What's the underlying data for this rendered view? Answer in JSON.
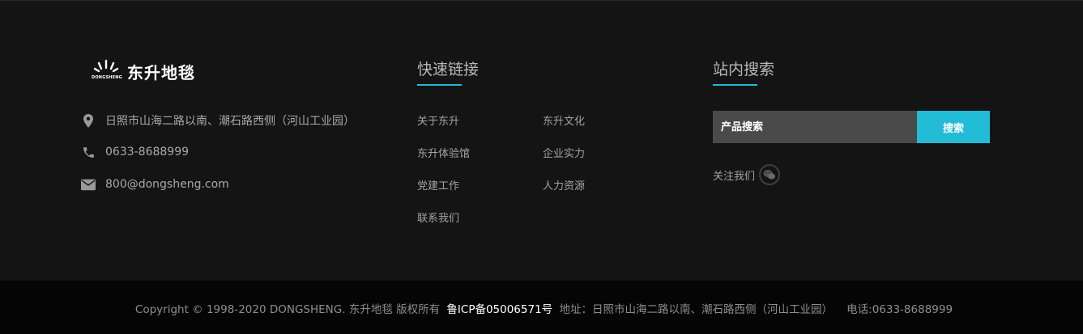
{
  "brand": {
    "name": "东升地毯",
    "mini_text": "DONGSHENG"
  },
  "contact": {
    "address": "日照市山海二路以南、潮石路西侧（河山工业园）",
    "phone": "0633-8688999",
    "email": "800@dongsheng.com"
  },
  "quick_links": {
    "title": "快速链接",
    "items": [
      "关于东升",
      "东升文化",
      "东升体验馆",
      "企业实力",
      "党建工作",
      "人力资源",
      "联系我们"
    ]
  },
  "site_search": {
    "title": "站内搜索",
    "placeholder": "产品搜索",
    "button_label": "搜索",
    "follow_label": "关注我们"
  },
  "footer": {
    "copyright": "Copyright © 1998-2020 DONGSHENG. 东升地毯 版权所有",
    "icp": "鲁ICP备05006571号",
    "address": "地址：日照市山海二路以南、潮石路西侧（河山工业园）",
    "phone": "电话:0633-8688999"
  },
  "colors": {
    "background": "#141414",
    "bottom_bar": "#050505",
    "accent": "#23bcd6",
    "input_bg": "#4a4a4a"
  },
  "icons": [
    "map-pin-icon",
    "phone-icon",
    "mail-icon",
    "wechat-icon",
    "logo-rays-icon"
  ]
}
